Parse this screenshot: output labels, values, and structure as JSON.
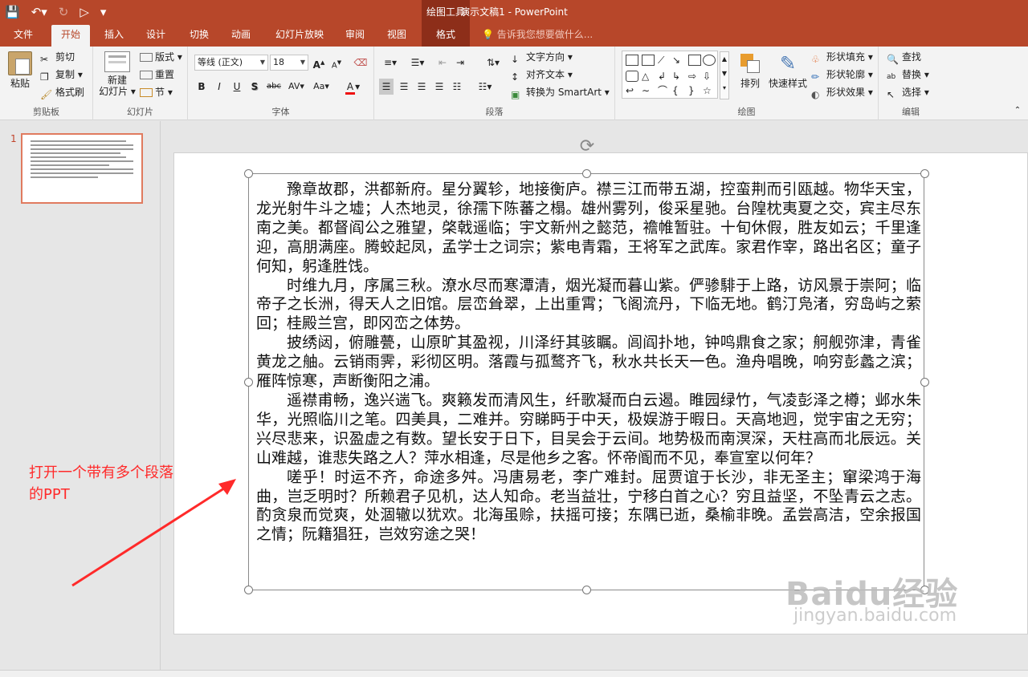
{
  "window": {
    "title": "演示文稿1 - PowerPoint",
    "context_group": "绘图工具"
  },
  "tabs": [
    {
      "label": "文件"
    },
    {
      "label": "开始"
    },
    {
      "label": "插入"
    },
    {
      "label": "设计"
    },
    {
      "label": "切换"
    },
    {
      "label": "动画"
    },
    {
      "label": "幻灯片放映"
    },
    {
      "label": "审阅"
    },
    {
      "label": "视图"
    },
    {
      "label": "格式"
    }
  ],
  "tell_me": "告诉我您想要做什么...",
  "clipboard": {
    "paste": "粘贴",
    "cut": "剪切",
    "copy": "复制",
    "format_painter": "格式刷",
    "label": "剪贴板"
  },
  "slides_group": {
    "new_slide_1": "新建",
    "new_slide_2": "幻灯片",
    "layout": "版式",
    "reset": "重置",
    "section": "节",
    "label": "幻灯片"
  },
  "font_group": {
    "font_name": "等线 (正文)",
    "font_size": "18",
    "label": "字体",
    "bold": "B",
    "italic": "I",
    "underline": "U",
    "shadow": "S",
    "strike": "abc",
    "spacing": "AV",
    "case": "Aa",
    "color": "A",
    "grow": "A",
    "shrink": "A"
  },
  "paragraph_group": {
    "text_direction": "文字方向",
    "align_text": "对齐文本",
    "smartart": "转换为 SmartArt",
    "label": "段落"
  },
  "drawing_group": {
    "arrange": "排列",
    "quick_styles": "快速样式",
    "shape_fill": "形状填充",
    "shape_outline": "形状轮廓",
    "shape_effects": "形状效果",
    "label": "绘图"
  },
  "editing_group": {
    "find": "查找",
    "replace": "替换",
    "select": "选择",
    "label": "编辑"
  },
  "thumbnail": {
    "number": "1"
  },
  "slide_paragraphs": [
    "豫章故郡，洪都新府。星分翼轸，地接衡庐。襟三江而带五湖，控蛮荆而引瓯越。物华天宝，龙光射牛斗之墟；人杰地灵，徐孺下陈蕃之榻。雄州雾列，俊采星驰。台隍枕夷夏之交，宾主尽东南之美。都督阎公之雅望，棨戟遥临；宇文新州之懿范，襜帷暂驻。十旬休假，胜友如云；千里逢迎，高朋满座。腾蛟起凤，孟学士之词宗；紫电青霜，王将军之武库。家君作宰，路出名区；童子何知，躬逢胜饯。",
    "时维九月，序属三秋。潦水尽而寒潭清，烟光凝而暮山紫。俨骖騑于上路，访风景于崇阿；临帝子之长洲，得天人之旧馆。层峦耸翠，上出重霄；飞阁流丹，下临无地。鹤汀凫渚，穷岛屿之萦回；桂殿兰宫，即冈峦之体势。",
    "披绣闼，俯雕甍，山原旷其盈视，川泽纡其骇瞩。闾阎扑地，钟鸣鼎食之家；舸舰弥津，青雀黄龙之舳。云销雨霁，彩彻区明。落霞与孤鹜齐飞，秋水共长天一色。渔舟唱晚，响穷彭蠡之滨；雁阵惊寒，声断衡阳之浦。",
    "遥襟甫畅，逸兴遄飞。爽籁发而清风生，纤歌凝而白云遏。睢园绿竹，气凌彭泽之樽；邺水朱华，光照临川之笔。四美具，二难并。穷睇眄于中天，极娱游于暇日。天高地迥，觉宇宙之无穷；兴尽悲来，识盈虚之有数。望长安于日下，目吴会于云间。地势极而南溟深，天柱高而北辰远。关山难越，谁悲失路之人？萍水相逢，尽是他乡之客。怀帝阍而不见，奉宣室以何年？",
    "嗟乎！时运不齐，命途多舛。冯唐易老，李广难封。屈贾谊于长沙，非无圣主；窜梁鸿于海曲，岂乏明时？所赖君子见机，达人知命。老当益壮，宁移白首之心？穷且益坚，不坠青云之志。酌贪泉而觉爽，处涸辙以犹欢。北海虽赊，扶摇可接；东隅已逝，桑榆非晚。孟尝高洁，空余报国之情；阮籍猖狂，岂效穷途之哭！"
  ],
  "annotation": {
    "line1": "打开一个带有多个段落",
    "line2": "的PPT"
  },
  "watermark": {
    "main": "Baidu经验",
    "sub": "jingyan.baidu.com"
  },
  "colors": {
    "accent": "#b7472a",
    "annotation": "#ff2a2a"
  }
}
